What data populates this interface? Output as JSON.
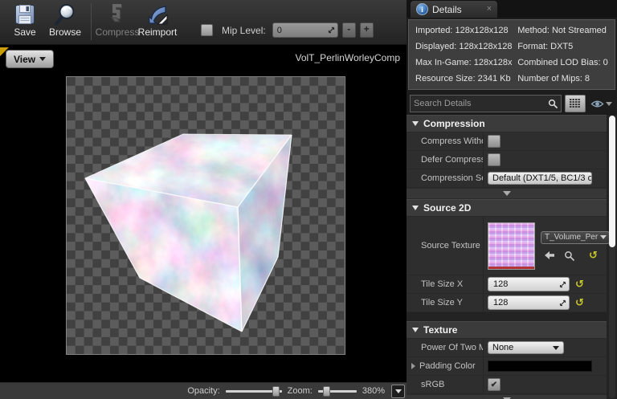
{
  "colors": {
    "accent_tab_yellow": "#c99e08",
    "reset_yellow": "#c9c92c",
    "checker_light": "#5c5c5c",
    "checker_dark": "#414141",
    "panel_bg": "#2e2e2e",
    "info_icon_blue": "#2a62a8",
    "scrollbar_thumb": "#f4f4f4"
  },
  "toolbar": {
    "save": "Save",
    "browse": "Browse",
    "compress": "Compress",
    "reimport": "Reimport",
    "mip_label": "Mip Level:",
    "mip_value": "0",
    "mip_minus": "-",
    "mip_plus": "+"
  },
  "viewport": {
    "view_button": "View",
    "asset_title": "VolT_PerlinWorleyComp",
    "opacity_label": "Opacity:",
    "zoom_label": "Zoom:",
    "zoom_value": "380%"
  },
  "details": {
    "tab_title": "Details",
    "close_glyph": "×",
    "info_rows": [
      {
        "left": "Imported: 128x128x128",
        "right": "Method: Not Streamed"
      },
      {
        "left": "Displayed: 128x128x128",
        "right": "Format: DXT5"
      },
      {
        "left": "Max In-Game: 128x128x",
        "right": "Combined LOD Bias: 0"
      },
      {
        "left": "Resource Size: 2341 Kb",
        "right": "Number of Mips: 8"
      }
    ],
    "search_placeholder": "Search Details",
    "compression": {
      "title": "Compression",
      "compress_without_label": "Compress Witho",
      "defer_label": "Defer Compress",
      "settings_label": "Compression Se",
      "settings_value": "Default (DXT1/5, BC1/3 or"
    },
    "source2d": {
      "title": "Source 2D",
      "source_texture_label": "Source Texture",
      "source_texture_value": "T_Volume_Per",
      "tile_x_label": "Tile Size X",
      "tile_x_value": "128",
      "tile_y_label": "Tile Size Y",
      "tile_y_value": "128"
    },
    "texture": {
      "title": "Texture",
      "pot_label": "Power Of Two M",
      "pot_value": "None",
      "padding_label": "Padding Color",
      "srgb_label": "sRGB"
    }
  }
}
